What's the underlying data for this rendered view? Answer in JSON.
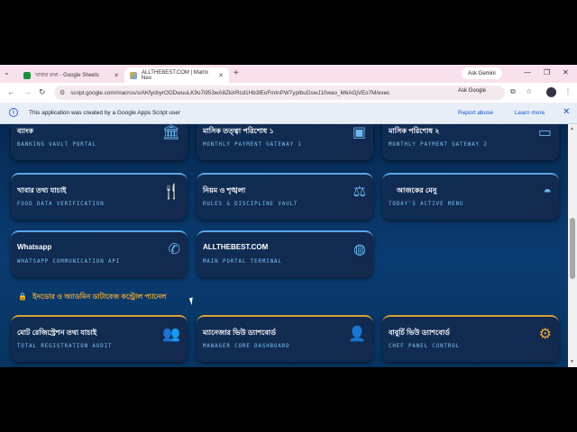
{
  "browser": {
    "tabs": [
      {
        "label": "খাবার তথ্য - Google Sheets",
        "favicon_color": "#1e8e3e"
      },
      {
        "label": "ALLTHEBEST.COM | Matrix Neo",
        "favicon_color": "#e8a83a"
      }
    ],
    "new_tab": "+",
    "ask_gemini": "Ask Gemini",
    "url": "script.google.com/macros/s/AKfycbyrOODwuuLK9o7i953wA8ZkIrRcd1Hb3lEoFmtnPW7ypIbuGswJ10wao_M6AGjVEo7M/exec",
    "ask_google": "Ask Google"
  },
  "infobar": {
    "message": "This application was created by a Google Apps Script user",
    "report_abuse": "Report abuse",
    "learn_more": "Learn more"
  },
  "cards": [
    {
      "title": "ব্যাংক",
      "subtitle": "BANKING VAULT PORTAL",
      "icon": "bank-icon"
    },
    {
      "title": "মাসিক তত্ত্বা পরিশোধ ১",
      "subtitle": "MONTHLY PAYMENT GATEWAY 1",
      "icon": "money-icon"
    },
    {
      "title": "মাসিক পরিশোধ ২",
      "subtitle": "MONTHLY PAYMENT GATEWAY 2",
      "icon": "card-icon"
    },
    {
      "title": "খাবার তথ্য যাচাই",
      "subtitle": "FOOD DATA VERIFICATION",
      "icon": "utensils-icon"
    },
    {
      "title": "নিয়ম ও শৃঙ্খলা",
      "subtitle": "RULES & DISCIPLINE VAULT",
      "icon": "scales-icon"
    },
    {
      "title": "আজকের মেনু",
      "subtitle": "TODAY'S ACTIVE MENU",
      "icon": "bowl-icon"
    },
    {
      "title": "Whatsapp",
      "subtitle": "WHATSAPP COMMUNICATION API",
      "icon": "whatsapp-icon"
    },
    {
      "title": "ALLTHEBEST.COM",
      "subtitle": "MAIN PORTAL TERMINAL",
      "icon": "globe-icon"
    }
  ],
  "section": {
    "title": "ইনডোর ও অ্যাডমিন ডাটাবেজ কন্ট্রোল প্যানেল"
  },
  "admin_cards": [
    {
      "title": "মোট রেজিস্ট্রেশন তথ্য যাচাই",
      "subtitle": "TOTAL REGISTRATION AUDIT",
      "icon": "users-icon"
    },
    {
      "title": "ম্যানেজার ভিউ ড্যাশবোর্ড",
      "subtitle": "MANAGER CORE DASHBOARD",
      "icon": "manager-icon"
    },
    {
      "title": "বাবুর্চি ভিউ ড্যাশবোর্ড",
      "subtitle": "CHEF PANEL CONTROL",
      "icon": "chef-icon"
    }
  ],
  "colors": {
    "accent_blue": "#5aa8e8",
    "accent_gold": "#d8a23a",
    "page_bg": "#0a3c72"
  }
}
